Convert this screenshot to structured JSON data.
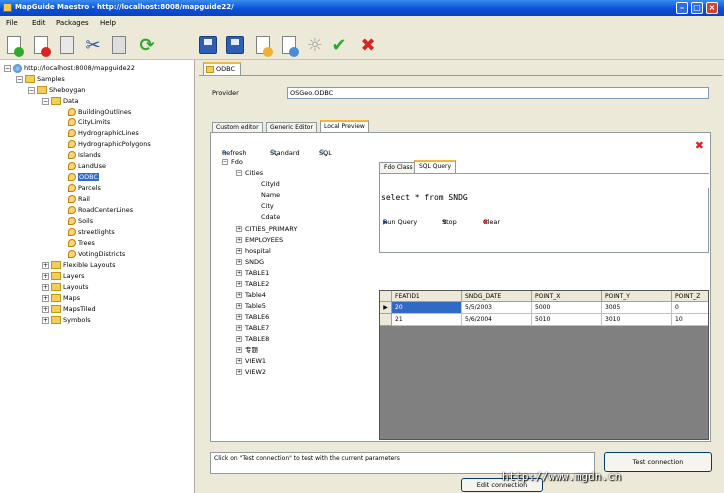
{
  "window": {
    "title": "MapGuide Maestro - http://localhost:8008/mapguide22/"
  },
  "menu": [
    "File",
    "Edit",
    "Packages",
    "Help"
  ],
  "tree": {
    "server": "http://localhost:8008/mapguide22",
    "samples": "Samples",
    "sheboygan": "Sheboygan",
    "data": "Data",
    "data_items": [
      "BuildingOutlines",
      "CityLimits",
      "HydrographicLines",
      "HydrographicPolygons",
      "Islands",
      "LandUse",
      "ODBC",
      "Parcels",
      "Rail",
      "RoadCenterLines",
      "Soils",
      "streetlights",
      "Trees",
      "VotingDistricts"
    ],
    "sibling_folders": [
      "Flexible Layouts",
      "Layers",
      "Layouts",
      "Maps",
      "MapsTiled",
      "Symbols"
    ]
  },
  "editor": {
    "doc_tab": "ODBC",
    "provider_label": "Provider",
    "provider_value": "OSGeo.ODBC",
    "tabs": [
      "Custom editor",
      "Generic Editor",
      "Local Preview"
    ],
    "active_tab": "Local Preview",
    "preview_toolbar": {
      "refresh": "Refresh",
      "standard": "Standard",
      "sql": "SQL"
    },
    "schema_tree": {
      "root": "Fdo",
      "cities": "Cities",
      "city_fields": [
        "CityId",
        "Name",
        "City",
        "Cdate"
      ],
      "classes": [
        "CITIES_PRIMARY",
        "EMPLOYEES",
        "hospital",
        "SNDG",
        "TABLE1",
        "TABLE2",
        "Table4",
        "Table5",
        "TABLE6",
        "TABLE7",
        "TABLE8",
        "专题",
        "VIEW1",
        "VIEW2"
      ]
    },
    "query_tabs": [
      "Fdo Class",
      "SQL Query"
    ],
    "query_toolbar": {
      "run": "Run Query",
      "stop": "Stop",
      "clear": "Clear"
    },
    "query_text": "select * from SNDG",
    "grid": {
      "columns": [
        "FEATID1",
        "SNDG_DATE",
        "POINT_X",
        "POINT_Y",
        "POINT_Z"
      ],
      "rows": [
        [
          "20",
          "5/5/2003",
          "5000",
          "3005",
          "0"
        ],
        [
          "21",
          "5/6/2004",
          "5010",
          "3010",
          "10"
        ]
      ]
    },
    "status_text": "Click on \"Test connection\" to test with the current parameters",
    "test_button": "Test connection",
    "edit_button": "Edit connection"
  },
  "watermark": "http://www.mgdn.cn"
}
